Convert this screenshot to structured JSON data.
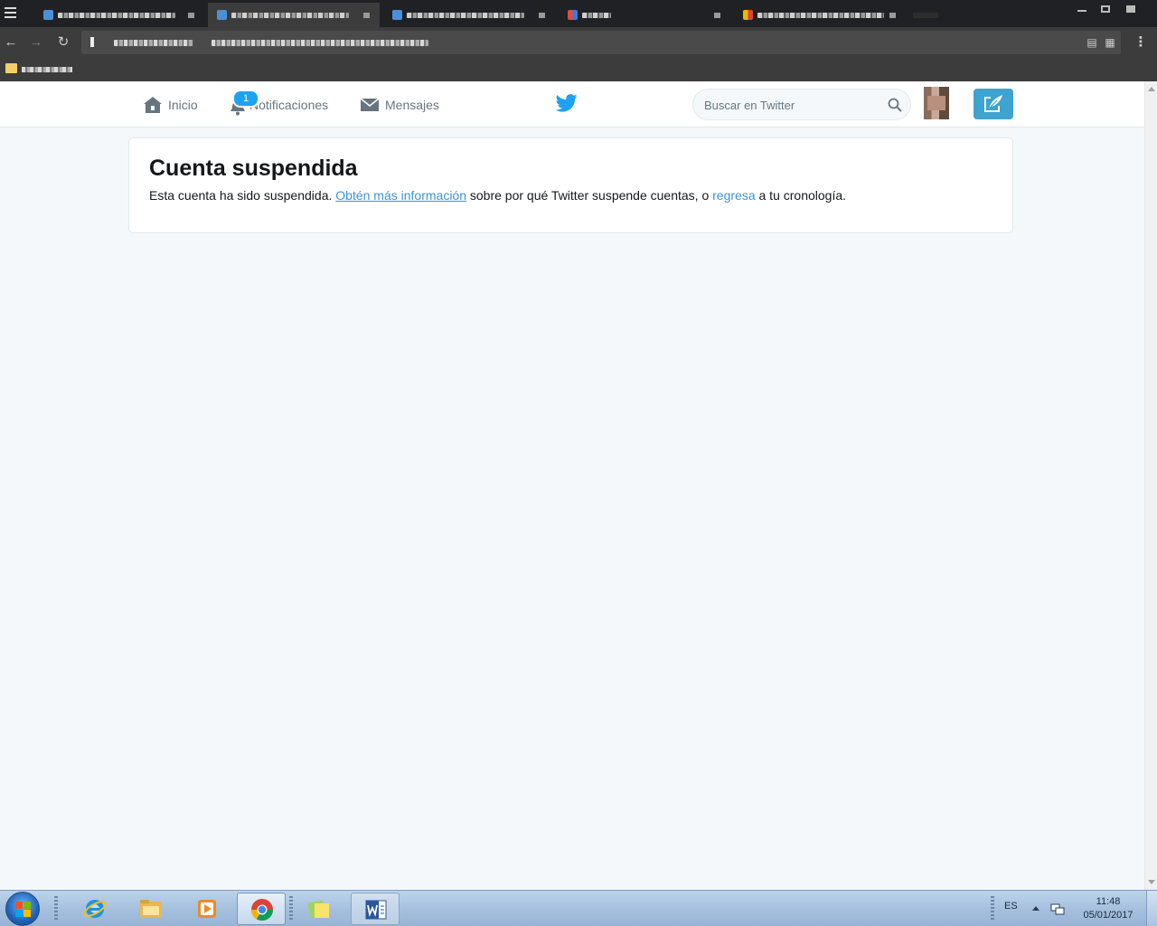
{
  "twitter": {
    "nav": {
      "home_label": "Inicio",
      "notifications_label": "Notificaciones",
      "notifications_count": "1",
      "messages_label": "Mensajes"
    },
    "search": {
      "placeholder": "Buscar en Twitter"
    },
    "card": {
      "title": "Cuenta suspendida",
      "text_before": "Esta cuenta ha sido suspendida. ",
      "learn_more_link": "Obtén más información",
      "text_middle": " sobre por qué Twitter suspende cuentas, o ",
      "back_link": "regresa",
      "text_after": " a tu cronología."
    },
    "colors": {
      "brand_blue": "#1da1f2",
      "link_blue": "#3b94d9",
      "tweet_button": "#3ea3ce",
      "page_background": "#f5f8fa"
    }
  },
  "taskbar": {
    "language": "ES",
    "time": "11:48",
    "date": "05/01/2017",
    "apps": [
      {
        "icon": "internet-explorer-icon"
      },
      {
        "icon": "file-explorer-icon"
      },
      {
        "icon": "media-player-icon"
      },
      {
        "icon": "chrome-icon",
        "active": true
      },
      {
        "icon": "sticky-notes-icon"
      },
      {
        "icon": "word-icon"
      }
    ]
  }
}
